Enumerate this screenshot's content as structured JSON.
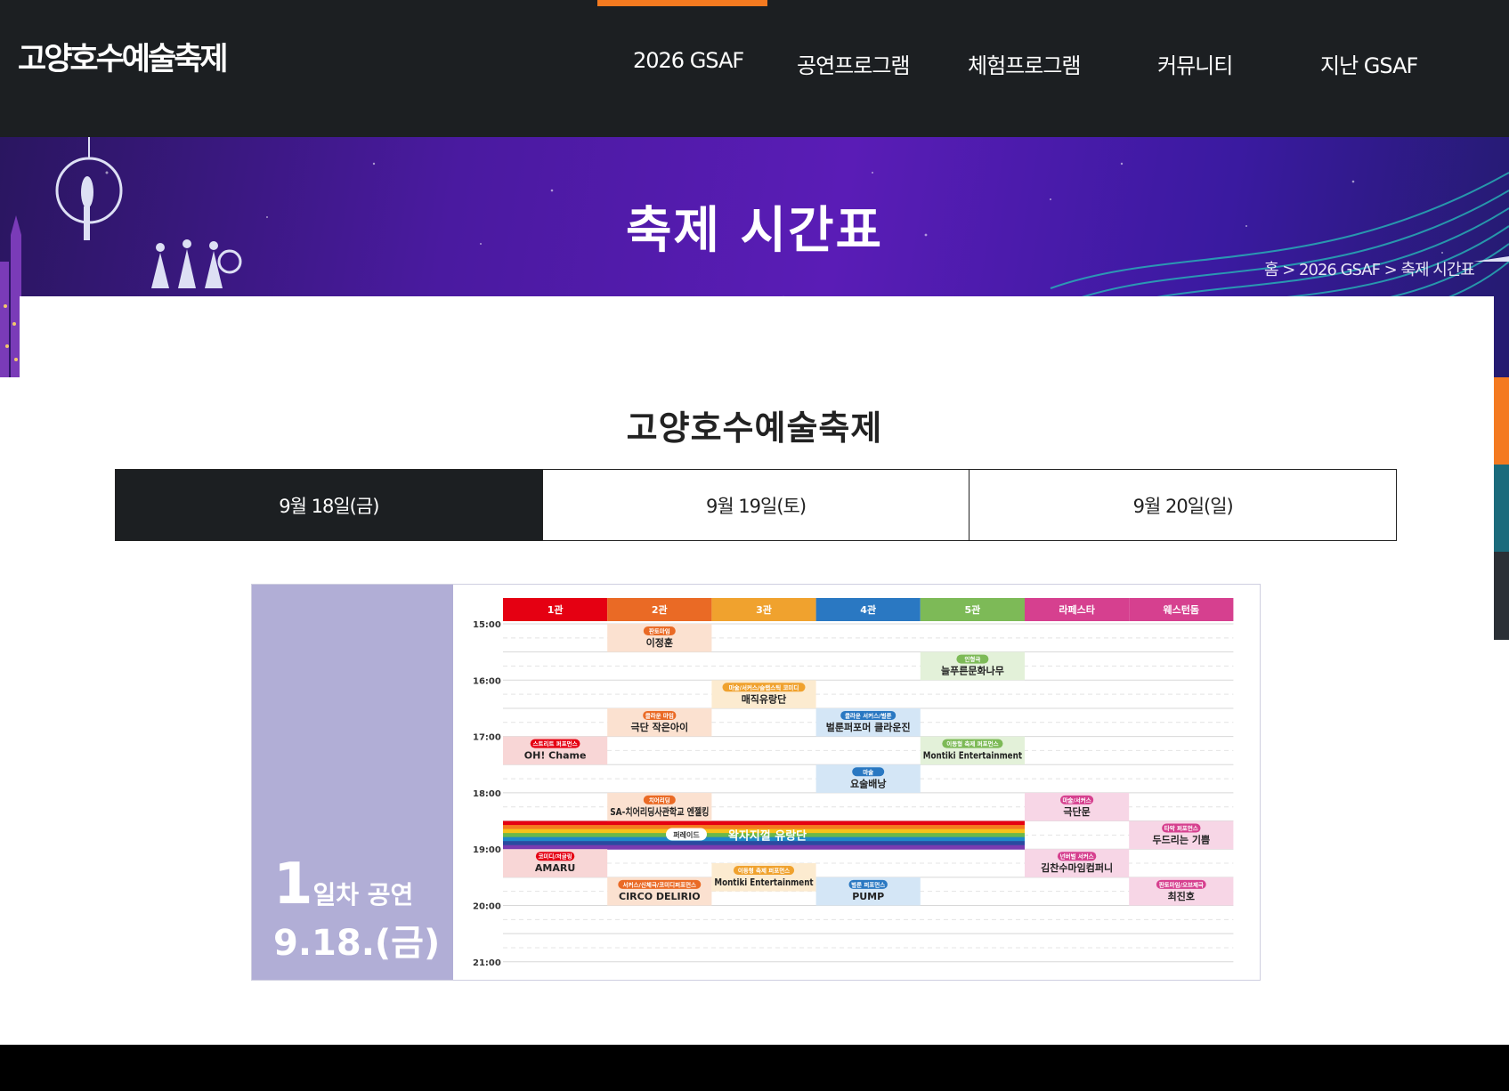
{
  "header": {
    "logo": "고양호수예술축제",
    "nav": [
      "2026 GSAF",
      "공연프로그램",
      "체험프로그램",
      "커뮤니티",
      "지난 GSAF"
    ]
  },
  "hero": {
    "title": "축제 시간표",
    "breadcrumb": "홈 > 2026 GSAF > 축제 시간표"
  },
  "main": {
    "title": "고양호수예술축제",
    "date_tabs": [
      "9월 18일(금)",
      "9월 19일(토)",
      "9월 20일(일)"
    ],
    "active_tab": 0
  },
  "schedule": {
    "day_number": "1",
    "day_label": "일차 공연",
    "day_date": "9.18.(금)",
    "venues": [
      {
        "name": "1관",
        "color": "#e50012"
      },
      {
        "name": "2관",
        "color": "#ea6a25"
      },
      {
        "name": "3관",
        "color": "#f0a22e"
      },
      {
        "name": "4관",
        "color": "#2a78c2"
      },
      {
        "name": "5관",
        "color": "#7dba57"
      },
      {
        "name": "라페스타",
        "color": "#d6408f"
      },
      {
        "name": "웨스턴돔",
        "color": "#d6408f"
      }
    ],
    "times": [
      "15:00",
      "16:00",
      "17:00",
      "18:00",
      "19:00",
      "20:00",
      "21:00"
    ],
    "events": [
      {
        "venue": 1,
        "start": 15.0,
        "end": 15.5,
        "tag": "판토마임",
        "name": "이정훈"
      },
      {
        "venue": 4,
        "start": 15.5,
        "end": 16.0,
        "tag": "인형극",
        "name": "늘푸른문화나무"
      },
      {
        "venue": 2,
        "start": 16.0,
        "end": 16.5,
        "tag": "마술/서커스/슬랩스틱 코미디",
        "name": "매직유랑단"
      },
      {
        "venue": 1,
        "start": 16.5,
        "end": 17.0,
        "tag": "클라운 마임",
        "name": "극단 작은아이"
      },
      {
        "venue": 3,
        "start": 16.5,
        "end": 17.0,
        "tag": "클라운 서커스/벌룬",
        "name": "벌룬퍼포머 클라운진"
      },
      {
        "venue": 0,
        "start": 17.0,
        "end": 17.5,
        "tag": "스트리트 퍼포먼스",
        "name": "OH! Chame"
      },
      {
        "venue": 4,
        "start": 17.0,
        "end": 17.5,
        "tag": "이동형 축제 퍼포먼스",
        "name": "Montiki Entertainment"
      },
      {
        "venue": 3,
        "start": 17.5,
        "end": 18.0,
        "tag": "마술",
        "name": "요술배낭"
      },
      {
        "venue": 1,
        "start": 18.0,
        "end": 18.5,
        "tag": "치어리딩",
        "name": "SA-치어리딩사관학교 엔젤킹"
      },
      {
        "venue": 5,
        "start": 18.0,
        "end": 18.5,
        "tag": "마술/서커스",
        "name": "극단문"
      },
      {
        "venue": 6,
        "start": 18.5,
        "end": 19.0,
        "tag": "타악 퍼포먼스",
        "name": "두드리는 기쁨"
      },
      {
        "venue": 0,
        "start": 19.0,
        "end": 19.5,
        "tag": "코미디/저글링",
        "name": "AMARU"
      },
      {
        "venue": 5,
        "start": 19.0,
        "end": 19.5,
        "tag": "넌버벌 서커스",
        "name": "김찬수마임컴퍼니"
      },
      {
        "venue": 1,
        "start": 19.5,
        "end": 20.0,
        "tag": "서커스/신체극/코미디퍼포먼스",
        "name": "CIRCO DELIRIO"
      },
      {
        "venue": 2,
        "start": 19.25,
        "end": 19.75,
        "tag": "이동형 축제 퍼포먼스",
        "name": "Montiki Entertainment"
      },
      {
        "venue": 3,
        "start": 19.5,
        "end": 20.0,
        "tag": "벌룬 퍼포먼스",
        "name": "PUMP"
      },
      {
        "venue": 6,
        "start": 19.5,
        "end": 20.0,
        "tag": "판토마임/오브제극",
        "name": "최진호"
      }
    ],
    "parade": {
      "tag": "퍼레이드",
      "name": "왁자지껄 유랑단",
      "start": 18.5,
      "end": 19.0
    }
  }
}
